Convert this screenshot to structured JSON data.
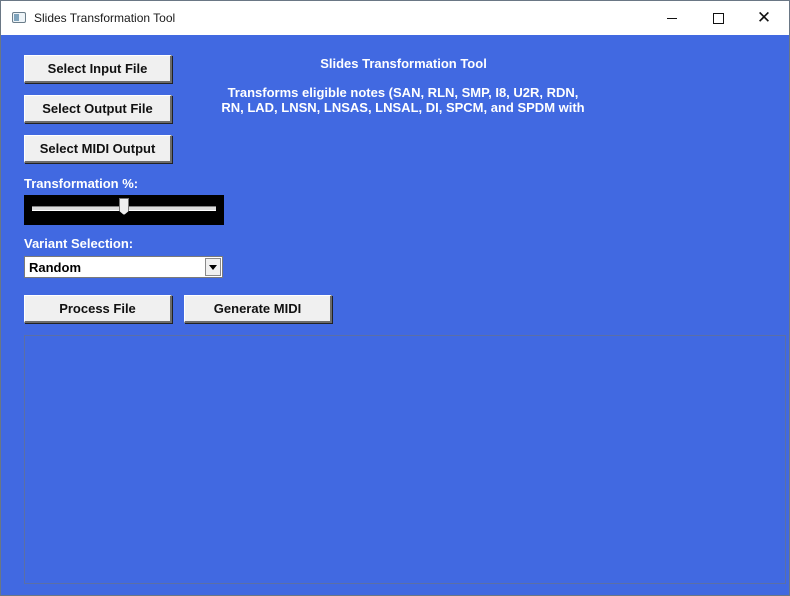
{
  "window": {
    "title": "Slides Transformation Tool",
    "controls": {
      "minimize": "minimize",
      "maximize": "maximize",
      "close": "✕"
    }
  },
  "main": {
    "heading": "Slides Transformation Tool",
    "description_line1": "Transforms eligible notes (SAN, RLN, SMP, I8, U2R, RDN,",
    "description_line2": "RN, LAD, LNSN, LNSAS, LNSAL, DI, SPCM, and SPDM with",
    "buttons": {
      "select_input": "Select Input File",
      "select_output": "Select Output File",
      "select_midi": "Select MIDI Output",
      "process": "Process File",
      "generate_midi": "Generate MIDI"
    },
    "transformation": {
      "label": "Transformation %:",
      "value_fraction": 0.5
    },
    "variant": {
      "label": "Variant Selection:",
      "selected": "Random"
    },
    "output_text": ""
  },
  "colors": {
    "background": "#4169e1",
    "text": "#ffffff",
    "button": "#f0f0f0"
  }
}
